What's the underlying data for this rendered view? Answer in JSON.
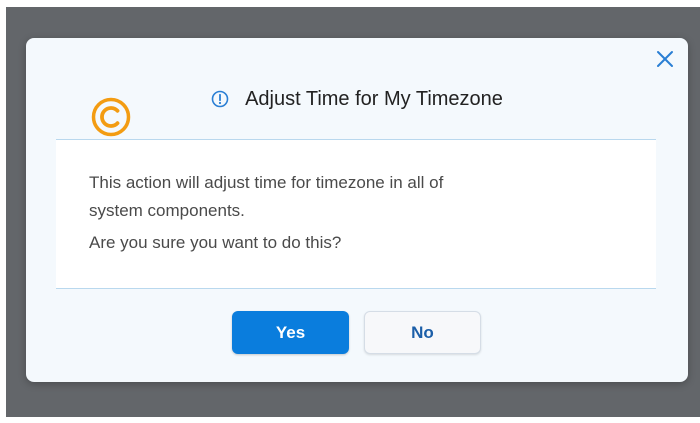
{
  "dialog": {
    "title": "Adjust Time for My Timezone",
    "title_icon": "info-icon",
    "close_icon": "close-icon",
    "message_line1": "This action will adjust time for timezone in all of",
    "message_line2": "system components.",
    "message_line3": "Are you sure you want to do this?",
    "yes_label": "Yes",
    "no_label": "No"
  },
  "watermark": {
    "symbol": "©",
    "icon": "copyright-icon"
  },
  "colors": {
    "backdrop": "#63666a",
    "dialog_bg": "#f4f9fd",
    "primary": "#0a7ddd",
    "watermark": "#f39c12"
  }
}
